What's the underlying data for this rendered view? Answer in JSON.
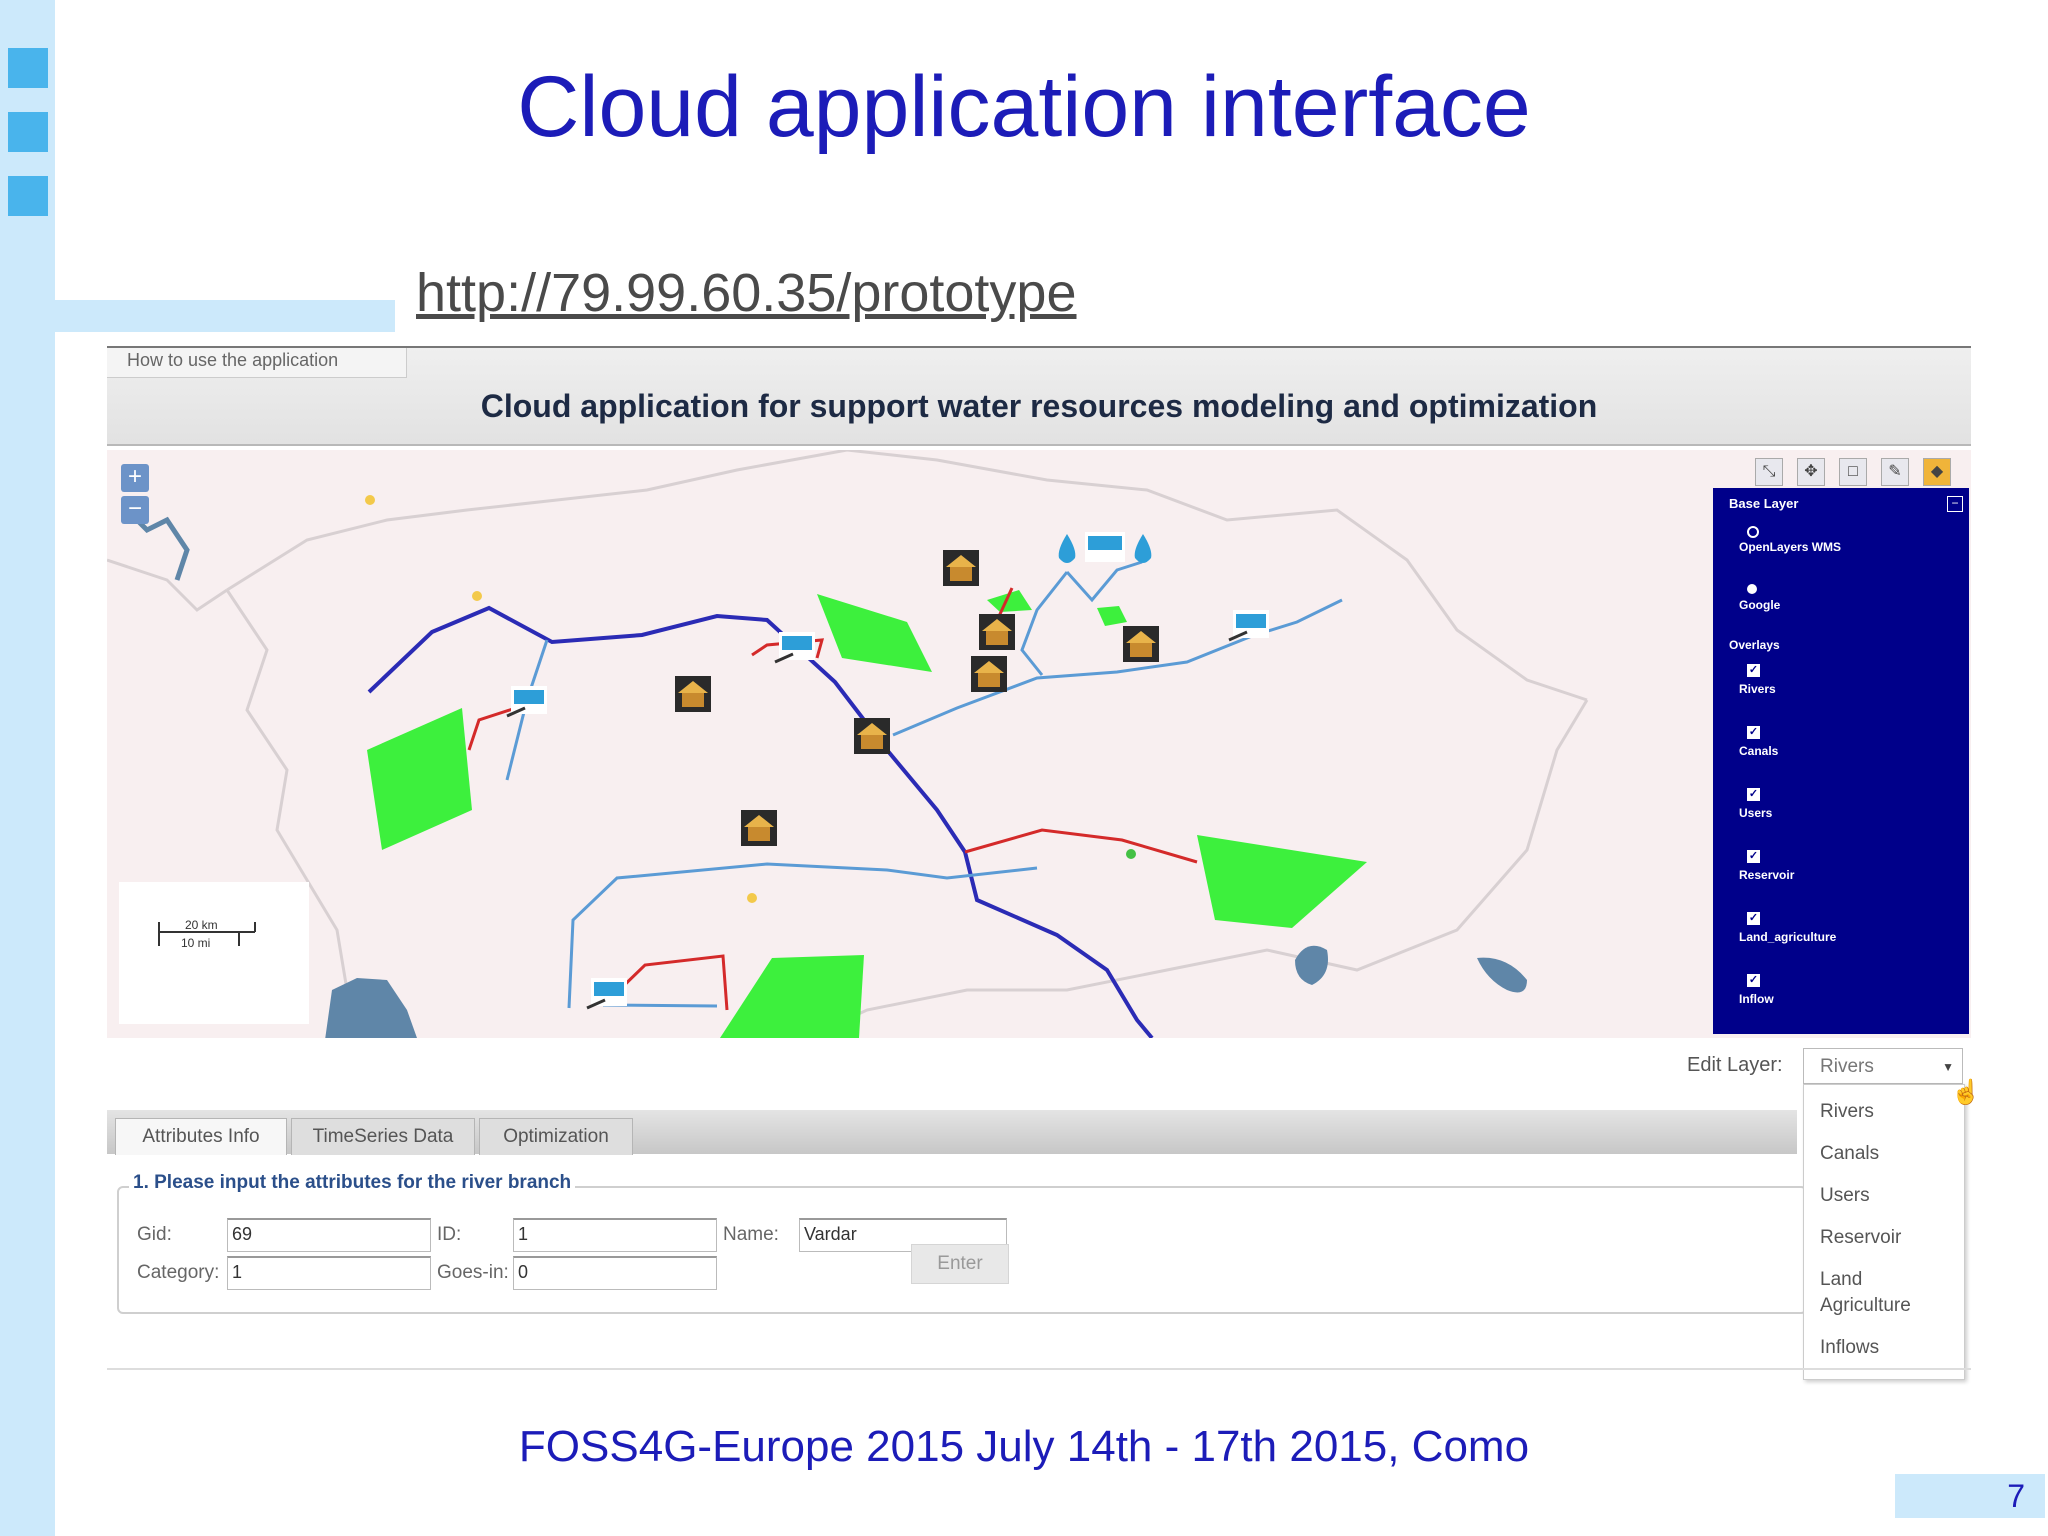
{
  "slide": {
    "title": "Cloud application interface",
    "url": "http://79.99.60.35/prototype",
    "footer": "FOSS4G-Europe 2015 July 14th - 17th 2015, Como",
    "page_number": "7"
  },
  "app": {
    "how_to_link": "How to use the application",
    "title": "Cloud application for support water resources modeling and optimization",
    "map": {
      "zoom_in": "+",
      "zoom_out": "−",
      "scale_km": "20 km",
      "scale_mi": "10 mi"
    },
    "layer_switcher": {
      "base_layer_heading": "Base Layer",
      "base_layers": [
        "OpenLayers WMS",
        "Google"
      ],
      "overlays_heading": "Overlays",
      "overlays": [
        "Rivers",
        "Canals",
        "Users",
        "Reservoir",
        "Land_agriculture",
        "Inflow"
      ]
    },
    "edit_layer": {
      "label": "Edit Layer:",
      "selected": "Rivers",
      "options": [
        "Rivers",
        "Canals",
        "Users",
        "Reservoir",
        "Land\nAgriculture",
        "Inflows"
      ]
    },
    "tabs": [
      "Attributes Info",
      "TimeSeries Data",
      "Optimization"
    ],
    "form": {
      "legend": "1. Please input the attributes for the river branch",
      "gid_label": "Gid:",
      "gid_value": "69",
      "id_label": "ID:",
      "id_value": "1",
      "name_label": "Name:",
      "name_value": "Vardar",
      "category_label": "Category:",
      "category_value": "1",
      "goes_in_label": "Goes-in:",
      "goes_in_value": "0",
      "enter_button": "Enter"
    },
    "colors": {
      "river": "#2b2bb5",
      "canal": "#5b9bd5",
      "link": "#d42a2a",
      "land_agriculture": "#3df03d",
      "layer_panel": "#00008a"
    }
  }
}
